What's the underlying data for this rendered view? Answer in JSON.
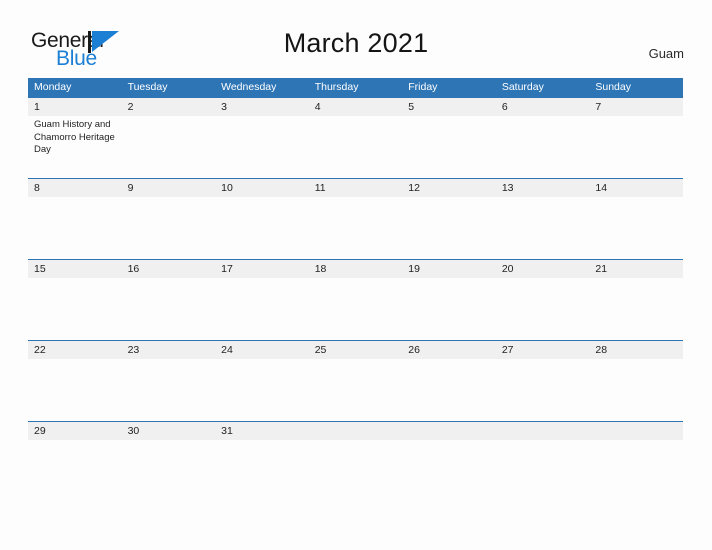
{
  "brand": {
    "name_line1": "General",
    "name_line2": "Blue",
    "flag_icon": "blue-triangle-flag-icon",
    "color_dark": "#1a1a1a",
    "color_blue": "#1b7fd4"
  },
  "header": {
    "title": "March 2021",
    "location": "Guam"
  },
  "colors": {
    "header_blue": "#2e75b6",
    "date_band_gray": "#f0f0f0",
    "row_rule_blue": "#2e75b6",
    "page_background": "#fdfdfd",
    "text_dark": "#222222"
  },
  "calendar": {
    "month": "March",
    "year": "2021",
    "weekdays": [
      "Monday",
      "Tuesday",
      "Wednesday",
      "Thursday",
      "Friday",
      "Saturday",
      "Sunday"
    ],
    "weeks": [
      [
        {
          "date": "1",
          "event": "Guam History and Chamorro Heritage Day"
        },
        {
          "date": "2",
          "event": ""
        },
        {
          "date": "3",
          "event": ""
        },
        {
          "date": "4",
          "event": ""
        },
        {
          "date": "5",
          "event": ""
        },
        {
          "date": "6",
          "event": ""
        },
        {
          "date": "7",
          "event": ""
        }
      ],
      [
        {
          "date": "8",
          "event": ""
        },
        {
          "date": "9",
          "event": ""
        },
        {
          "date": "10",
          "event": ""
        },
        {
          "date": "11",
          "event": ""
        },
        {
          "date": "12",
          "event": ""
        },
        {
          "date": "13",
          "event": ""
        },
        {
          "date": "14",
          "event": ""
        }
      ],
      [
        {
          "date": "15",
          "event": ""
        },
        {
          "date": "16",
          "event": ""
        },
        {
          "date": "17",
          "event": ""
        },
        {
          "date": "18",
          "event": ""
        },
        {
          "date": "19",
          "event": ""
        },
        {
          "date": "20",
          "event": ""
        },
        {
          "date": "21",
          "event": ""
        }
      ],
      [
        {
          "date": "22",
          "event": ""
        },
        {
          "date": "23",
          "event": ""
        },
        {
          "date": "24",
          "event": ""
        },
        {
          "date": "25",
          "event": ""
        },
        {
          "date": "26",
          "event": ""
        },
        {
          "date": "27",
          "event": ""
        },
        {
          "date": "28",
          "event": ""
        }
      ],
      [
        {
          "date": "29",
          "event": ""
        },
        {
          "date": "30",
          "event": ""
        },
        {
          "date": "31",
          "event": ""
        },
        {
          "date": "",
          "event": ""
        },
        {
          "date": "",
          "event": ""
        },
        {
          "date": "",
          "event": ""
        },
        {
          "date": "",
          "event": ""
        }
      ]
    ]
  }
}
